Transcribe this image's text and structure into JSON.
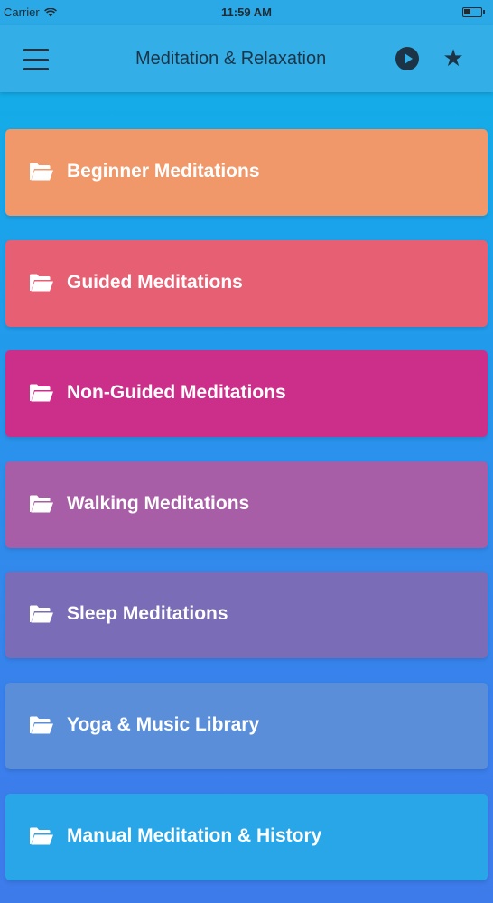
{
  "status_bar": {
    "carrier": "Carrier",
    "time": "11:59 AM"
  },
  "nav": {
    "title": "Meditation & Relaxation",
    "menu_icon": "hamburger-menu-icon",
    "play_icon": "play-circle-icon",
    "favorite_icon": "star-icon"
  },
  "categories": [
    {
      "label": "Beginner Meditations",
      "color": "#f0986a",
      "icon": "folder-open-icon"
    },
    {
      "label": "Guided Meditations",
      "color": "#e65f72",
      "icon": "folder-open-icon"
    },
    {
      "label": "Non-Guided Meditations",
      "color": "#cc2f8a",
      "icon": "folder-open-icon"
    },
    {
      "label": "Walking Meditations",
      "color": "#a85ea6",
      "icon": "folder-open-icon"
    },
    {
      "label": "Sleep Meditations",
      "color": "#7a6cb6",
      "icon": "folder-open-icon"
    },
    {
      "label": "Yoga & Music Library",
      "color": "#5a8ed8",
      "icon": "folder-open-icon"
    },
    {
      "label": "Manual Meditation & History",
      "color": "#28a6e8",
      "icon": "folder-open-icon"
    }
  ]
}
